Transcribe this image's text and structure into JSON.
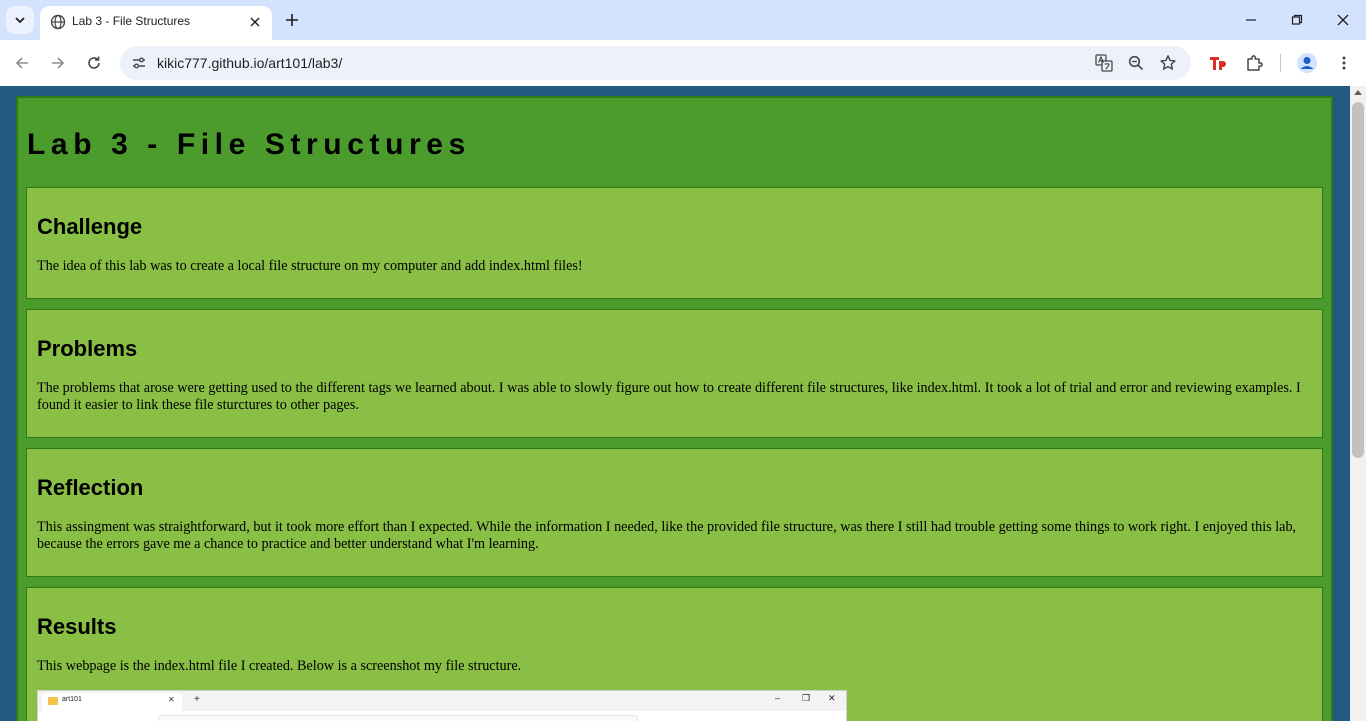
{
  "browser": {
    "tab": {
      "title": "Lab 3 - File Structures"
    },
    "address_bar": {
      "url": "kikic777.github.io/art101/lab3/"
    }
  },
  "page": {
    "title": "Lab 3 - File Structures",
    "sections": [
      {
        "heading": "Challenge",
        "paragraphs": [
          "The idea of this lab was to create a local file structure on my computer and add index.html files!"
        ]
      },
      {
        "heading": "Problems",
        "paragraphs": [
          "The problems that arose were getting used to the different tags we learned about. I was able to slowly figure out how to create different file structures, like index.html. It took a lot of trial and error and reviewing examples. I found it easier to link these file sturctures to other pages."
        ]
      },
      {
        "heading": "Reflection",
        "paragraphs": [
          "This assingment was straightforward, but it took more effort than I expected. While the information I needed, like the provided file structure, was there I still had trouble getting some things to work right. I enjoyed this lab, because the errors gave me a chance to practice and better understand what I'm learning."
        ]
      },
      {
        "heading": "Results",
        "paragraphs": [
          "This webpage is the index.html file I created. Below is a screenshot my file structure."
        ],
        "screenshot": {
          "tab_label": "art101"
        }
      }
    ]
  },
  "colors": {
    "page_background": "#235a83",
    "container": "#4c9c2d",
    "section": "#89bf45",
    "border": "#2e7a17"
  }
}
